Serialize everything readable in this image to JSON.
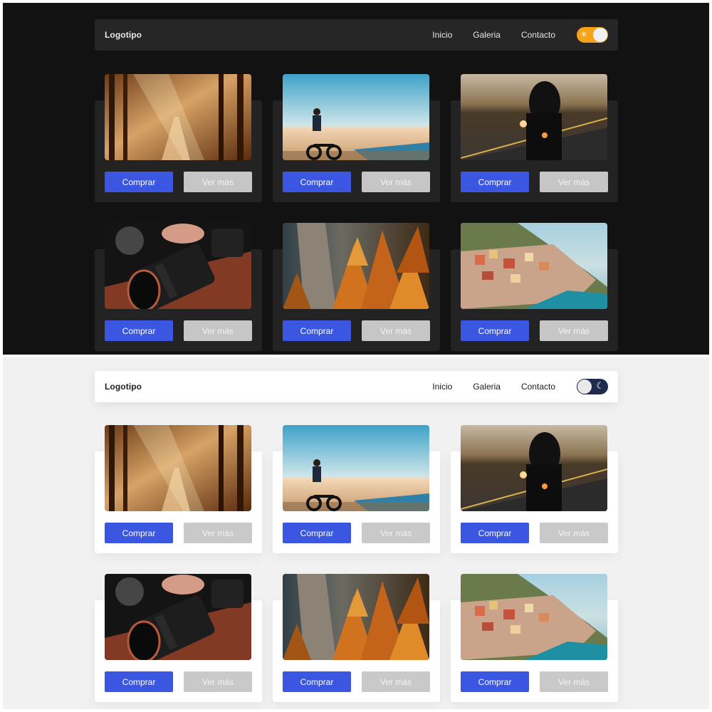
{
  "themes": {
    "dark": {
      "nav": {
        "logo": "Logotipo",
        "links": [
          "Inicio",
          "Galeria",
          "Contacto"
        ],
        "toggle_icon": "☀"
      }
    },
    "light": {
      "nav": {
        "logo": "Logotipo",
        "links": [
          "Inicio",
          "Galeria",
          "Contacto"
        ],
        "toggle_icon": "☾"
      }
    }
  },
  "cards": [
    {
      "image": "forest-path-photo",
      "buy_label": "Comprar",
      "more_label": "Ver más"
    },
    {
      "image": "beach-ebike-rider-photo",
      "buy_label": "Comprar",
      "more_label": "Ver más"
    },
    {
      "image": "motorcycle-rider-photo",
      "buy_label": "Comprar",
      "more_label": "Ver más"
    },
    {
      "image": "camera-lens-photo",
      "buy_label": "Comprar",
      "more_label": "Ver más"
    },
    {
      "image": "autumn-cliff-photo",
      "buy_label": "Comprar",
      "more_label": "Ver más"
    },
    {
      "image": "coastal-village-photo",
      "buy_label": "Comprar",
      "more_label": "Ver más"
    }
  ],
  "colors": {
    "accent": "#3b57e2",
    "toggle_dark": "#f4a31a",
    "toggle_light": "#1e2b4d"
  }
}
